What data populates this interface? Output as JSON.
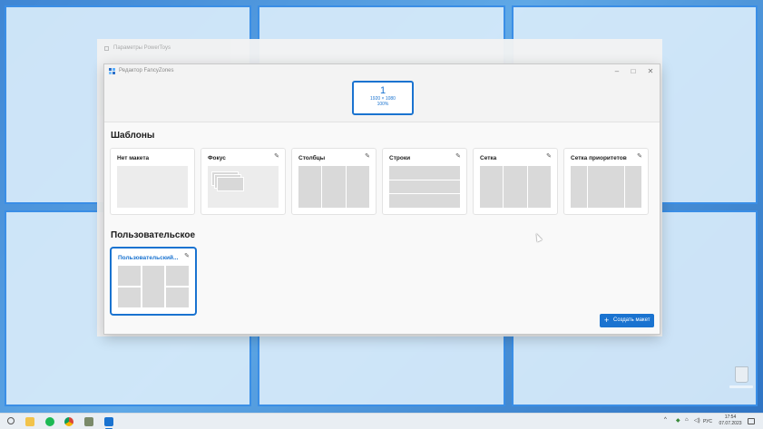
{
  "background_window": {
    "title": "Параметры PowerToys"
  },
  "editor": {
    "title": "Редактор FancyZones",
    "controls": {
      "minimize": "–",
      "maximize": "□",
      "close": "✕"
    },
    "monitor": {
      "number": "1",
      "resolution": "1920 × 1080",
      "scale": "100%"
    },
    "templates_title": "Шаблоны",
    "templates": [
      {
        "name": "Нет макета",
        "preview": "empty",
        "editable": false
      },
      {
        "name": "Фокус",
        "preview": "focus",
        "editable": true
      },
      {
        "name": "Столбцы",
        "preview": "columns",
        "editable": true
      },
      {
        "name": "Строки",
        "preview": "rows",
        "editable": true
      },
      {
        "name": "Сетка",
        "preview": "grid",
        "editable": true
      },
      {
        "name": "Сетка приоритетов",
        "preview": "priority-grid",
        "editable": true
      }
    ],
    "custom_title": "Пользовательское",
    "custom_layouts": [
      {
        "name": "Пользовательский...",
        "selected": true
      }
    ],
    "create_button": {
      "icon": "+",
      "label": "Создать макет"
    },
    "edit_icon": "✎",
    "accent_color": "#1a73d0"
  },
  "taskbar": {
    "apps": [
      "search-icon",
      "file-explorer-icon",
      "spotify-icon",
      "chrome-icon",
      "photos-icon",
      "fancyzones-icon"
    ],
    "tray": {
      "chevron": "^",
      "icon_a": "◆",
      "icon_b": "⌂",
      "icon_c": "◁)",
      "language": "РУС"
    },
    "clock": {
      "time": "17:54",
      "date": "07.07.2023"
    }
  }
}
